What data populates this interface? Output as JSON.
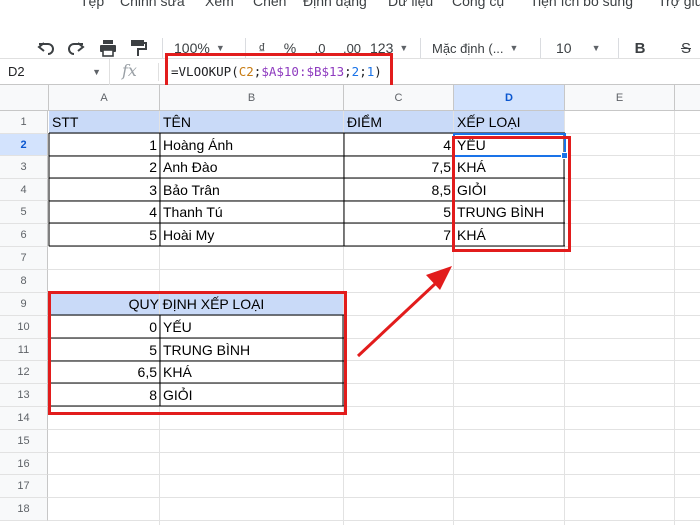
{
  "menu": {
    "items": [
      "Tệp",
      "Chỉnh sửa",
      "Xem",
      "Chèn",
      "Định dạng",
      "Dữ liệu",
      "Công cụ",
      "Tiện ích bổ sung",
      "Trợ giúp"
    ]
  },
  "toolbar": {
    "undo_icon": "undo-icon",
    "redo_icon": "redo-icon",
    "print_icon": "print-icon",
    "paint_format_icon": "paint-format-icon",
    "zoom": "100%",
    "currency": "₫",
    "percent": "%",
    "decimal_decrease": ".0",
    "decimal_increase": ".00",
    "more_formats": "123",
    "font": "Mặc định (...",
    "font_size": "10",
    "bold": "B",
    "strikethrough": "S"
  },
  "formula_bar": {
    "name_box": "D2",
    "fx": "fx",
    "formula_prefix": "=VLOOKUP(",
    "formula_ref": "C2",
    "formula_sep1": ";",
    "formula_range": "$A$10:$B$13",
    "formula_sep2": ";",
    "formula_col": "2",
    "formula_sep3": ";",
    "formula_match": "1",
    "formula_suffix": ")"
  },
  "columns": [
    "A",
    "B",
    "C",
    "D",
    "E"
  ],
  "rows": [
    "1",
    "2",
    "3",
    "4",
    "5",
    "6",
    "7",
    "8",
    "9",
    "10",
    "11",
    "12",
    "13",
    "14",
    "15",
    "16",
    "17",
    "18"
  ],
  "table1": {
    "headers": [
      "STT",
      "TÊN",
      "ĐIỂM",
      "XẾP LOẠI"
    ],
    "rows": [
      [
        "1",
        "Hoàng Ánh",
        "4",
        "YẾU"
      ],
      [
        "2",
        "Anh Đào",
        "7,5",
        "KHÁ"
      ],
      [
        "3",
        "Bảo Trân",
        "8,5",
        "GIỎI"
      ],
      [
        "4",
        "Thanh Tú",
        "5",
        "TRUNG BÌNH"
      ],
      [
        "5",
        "Hoài My",
        "7",
        "KHÁ"
      ]
    ]
  },
  "table2": {
    "header": "QUY ĐỊNH XẾP LOẠI",
    "rows": [
      [
        "0",
        "YẾU"
      ],
      [
        "5",
        "TRUNG BÌNH"
      ],
      [
        "6,5",
        "KHÁ"
      ],
      [
        "8",
        "GIỎI"
      ]
    ]
  },
  "colors": {
    "header_fill": "#c9daf8",
    "annotation_red": "#e21c1c",
    "selection_blue": "#1a73e8"
  }
}
